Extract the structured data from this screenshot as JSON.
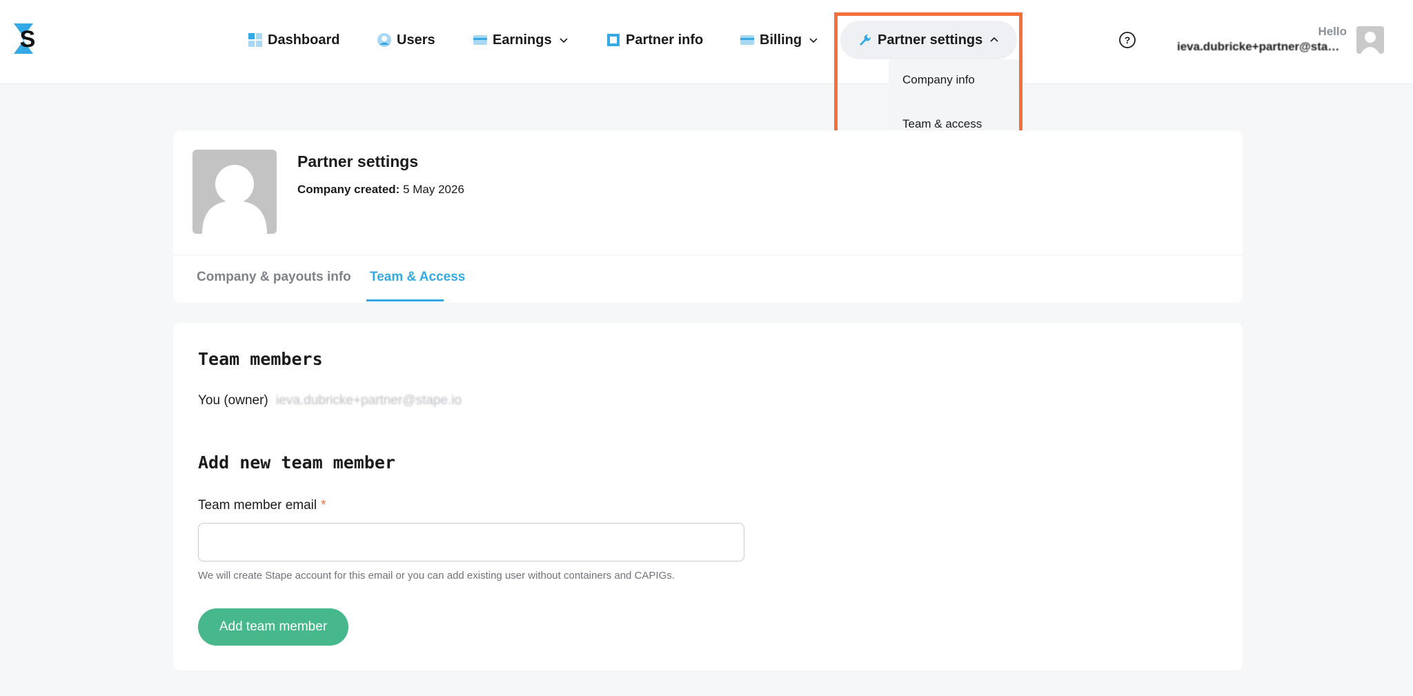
{
  "header": {
    "nav": [
      {
        "id": "dashboard",
        "label": "Dashboard",
        "icon": "dashboard-icon"
      },
      {
        "id": "users",
        "label": "Users",
        "icon": "user-icon"
      },
      {
        "id": "earnings",
        "label": "Earnings",
        "icon": "card-icon"
      },
      {
        "id": "partner-info",
        "label": "Partner info",
        "icon": "square-icon"
      },
      {
        "id": "billing",
        "label": "Billing",
        "icon": "card-icon"
      },
      {
        "id": "partner-settings",
        "label": "Partner settings",
        "icon": "wrench-icon"
      }
    ],
    "hello": "Hello",
    "user_email": "ieva.dubricke+partner@stape.io"
  },
  "dropdown": {
    "items": [
      "Company info",
      "Team & access"
    ]
  },
  "profile": {
    "title": "Partner settings",
    "created_label": "Company created:",
    "created_value": "5 May 2026"
  },
  "tabs": {
    "company": "Company & payouts info",
    "team": "Team & Access"
  },
  "team": {
    "members_heading": "Team members",
    "owner_label": "You (owner)",
    "owner_email": "ieva.dubricke+partner@stape.io",
    "add_heading": "Add new team member",
    "email_label": "Team member email",
    "required_mark": "*",
    "email_value": "",
    "hint": "We will create Stape account for this email or you can add existing user without containers and CAPIGs.",
    "add_button": "Add team member"
  },
  "colors": {
    "accent_blue": "#35a9e6",
    "highlight": "#f5703a",
    "button_green": "#46b88c"
  }
}
